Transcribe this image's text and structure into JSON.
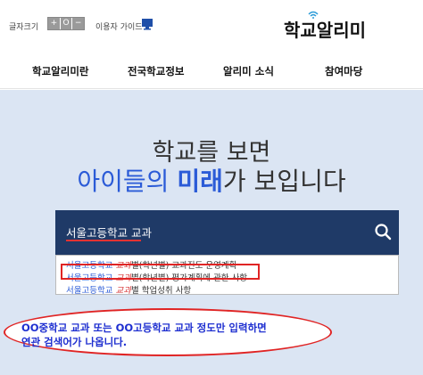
{
  "topbar": {
    "font_size_label": "글자크기",
    "font_controls": [
      "+",
      "O",
      "−"
    ],
    "guide_label": "이용자 가이드",
    "logo_text": "학교알리미"
  },
  "gnb": {
    "items": [
      "학교알리미란",
      "전국학교정보",
      "알리미 소식",
      "참여마당"
    ]
  },
  "hero": {
    "line1": "학교를 보면",
    "line2_part1": "아이들의 ",
    "line2_part2": "미래",
    "line2_part3": "가 보입니다"
  },
  "search": {
    "value": "서울고등학교 교과",
    "icon": "search-icon"
  },
  "suggestions": [
    {
      "prefix": "서울고등학교 ",
      "keyword": "교과",
      "suffix": "별(학년별) 교과진도 운영계획"
    },
    {
      "prefix": "서울고등학교 ",
      "keyword": "교과",
      "suffix": "별(학년별) 평가계획에 관한 사항"
    },
    {
      "prefix": "서울고등학교 ",
      "keyword": "교과",
      "suffix": "별 학업성취 사항"
    }
  ],
  "annotation": {
    "line1": "OO중학교 교과 또는 OO고등학교 교과 정도만 입력하면",
    "line2": "연관 검색어가 나옵니다."
  },
  "colors": {
    "hero_bg": "#dbe5f3",
    "search_bg": "#1f3a67",
    "accent_blue": "#2b5bd7",
    "annotation_red": "#e02424"
  }
}
